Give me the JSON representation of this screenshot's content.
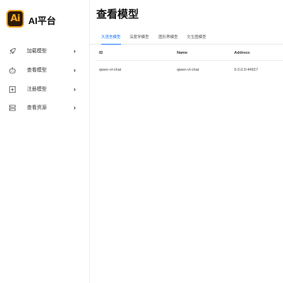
{
  "app": {
    "logo_text": "Ai",
    "brand_name": "AI平台"
  },
  "sidebar": {
    "items": [
      {
        "label": "加载模型",
        "icon": "rocket-icon",
        "chevron": "›"
      },
      {
        "label": "查看模型",
        "icon": "robot-icon",
        "chevron": "›"
      },
      {
        "label": "注册模型",
        "icon": "plus-square-icon",
        "chevron": "›"
      },
      {
        "label": "查看资源",
        "icon": "server-icon",
        "chevron": "›"
      }
    ]
  },
  "main": {
    "title": "查看模型",
    "tabs": [
      {
        "label": "大语言模型",
        "active": true
      },
      {
        "label": "深度学模型",
        "active": false
      },
      {
        "label": "图形界模型",
        "active": false
      },
      {
        "label": "文生图模型",
        "active": false
      }
    ],
    "table": {
      "columns": [
        "ID",
        "Name",
        "Address"
      ],
      "rows": [
        [
          "qwen-vl-chat",
          "qwen-vl-chat",
          "0.0.0.0:44927"
        ]
      ]
    }
  },
  "colors": {
    "accent": "#1677ff",
    "logo_bg": "#2d1a07",
    "logo_fg": "#f6a623"
  }
}
